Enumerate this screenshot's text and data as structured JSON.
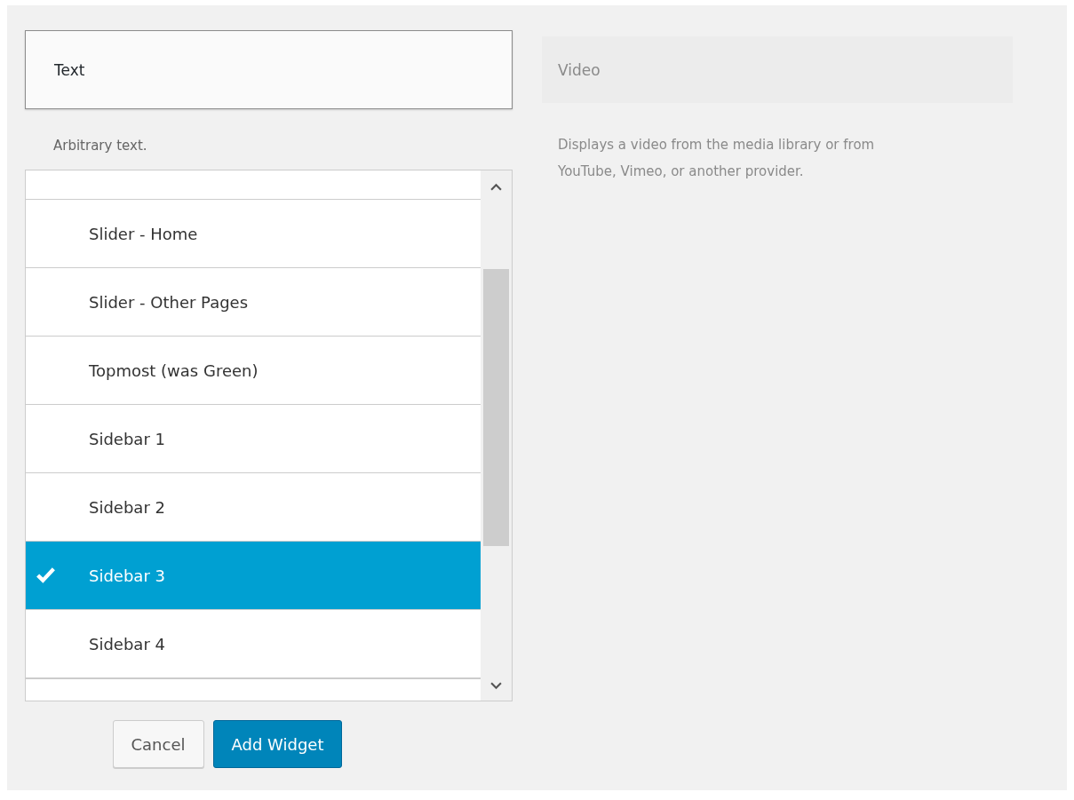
{
  "widgets": [
    {
      "title": "Text",
      "description": "Arbitrary text.",
      "selected": true
    },
    {
      "title": "Video",
      "description": "Displays a video from the media library or from YouTube, Vimeo, or another provider.",
      "selected": false
    }
  ],
  "sidebar_list": [
    {
      "label": "Slider - Home",
      "selected": false
    },
    {
      "label": "Slider - Other Pages",
      "selected": false
    },
    {
      "label": "Topmost (was Green)",
      "selected": false
    },
    {
      "label": "Sidebar 1",
      "selected": false
    },
    {
      "label": "Sidebar 2",
      "selected": false
    },
    {
      "label": "Sidebar 3",
      "selected": true
    },
    {
      "label": "Sidebar 4",
      "selected": false
    }
  ],
  "buttons": [
    {
      "label": "Cancel",
      "kind": "secondary"
    },
    {
      "label": "Add Widget",
      "kind": "primary"
    }
  ]
}
